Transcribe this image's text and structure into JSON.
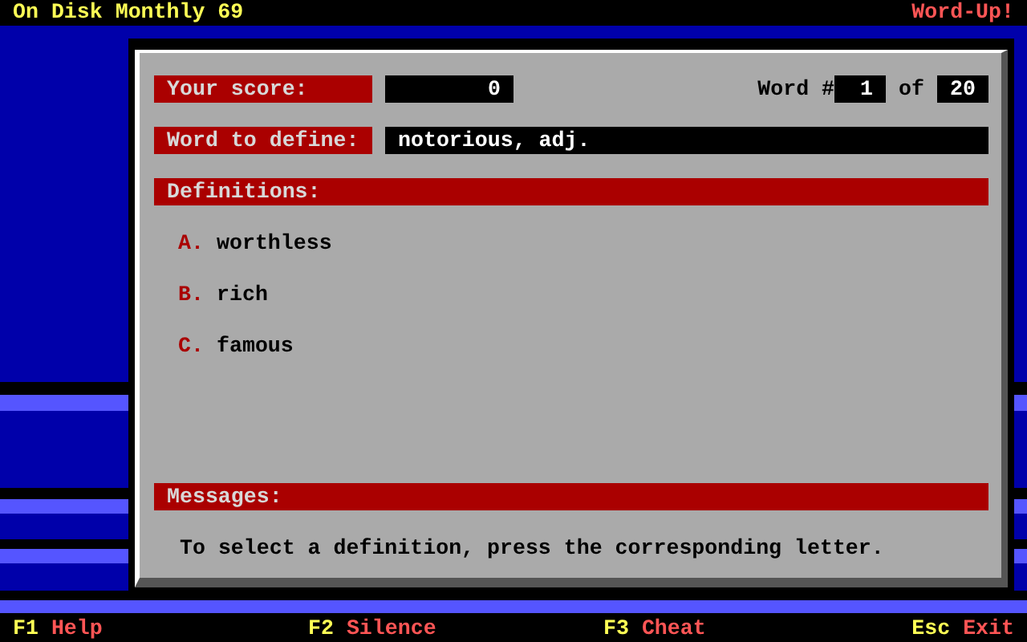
{
  "header": {
    "title": "On Disk Monthly 69",
    "app": "Word-Up!"
  },
  "score": {
    "label": "Your score:",
    "value": "0"
  },
  "word_counter": {
    "label": "Word #",
    "current": "1",
    "separator": "of",
    "total": "20"
  },
  "word": {
    "label": "Word to define:",
    "value": "notorious, adj."
  },
  "definitions": {
    "label": "Definitions:",
    "options": [
      {
        "letter": "A.",
        "text": "worthless"
      },
      {
        "letter": "B.",
        "text": "rich"
      },
      {
        "letter": "C.",
        "text": "famous"
      }
    ]
  },
  "messages": {
    "label": "Messages:",
    "text": "To select a definition, press the corresponding letter."
  },
  "function_keys": [
    {
      "key": "F1",
      "action": "Help"
    },
    {
      "key": "F2",
      "action": "Silence"
    },
    {
      "key": "F3",
      "action": "Cheat"
    },
    {
      "key": "Esc",
      "action": "Exit"
    }
  ]
}
